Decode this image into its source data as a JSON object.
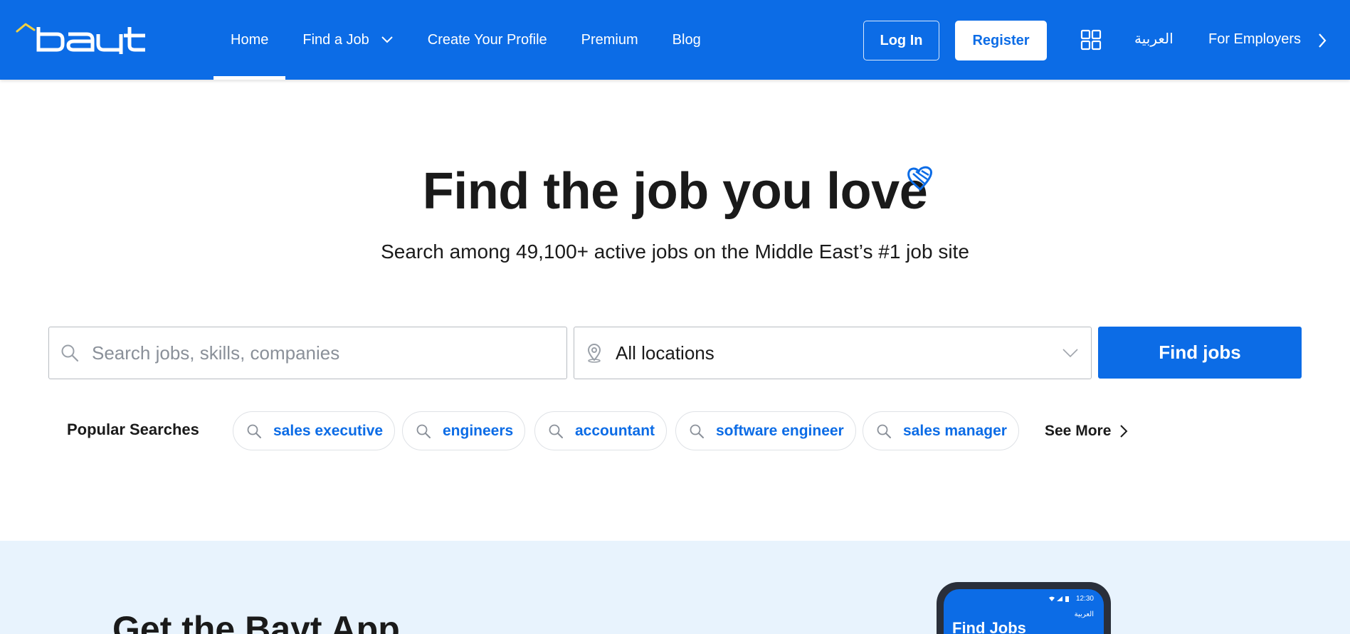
{
  "nav": {
    "links": [
      {
        "label": "Home"
      },
      {
        "label": "Find a Job"
      },
      {
        "label": "Create Your Profile"
      },
      {
        "label": "Premium"
      },
      {
        "label": "Blog"
      }
    ],
    "login_label": "Log In",
    "register_label": "Register",
    "language_label": "العربية",
    "employers_label": "For Employers",
    "icons": {
      "apps": "grid-apps-icon",
      "dropdown": "chevron-down-icon",
      "employers": "chevron-right-icon"
    }
  },
  "hero": {
    "title": "Find the job you love",
    "subtitle": "Search among 49,100+ active jobs on the Middle East’s #1 job site"
  },
  "search": {
    "placeholder": "Search jobs, skills, companies",
    "location_value": "All locations",
    "button_label": "Find jobs"
  },
  "popular": {
    "label": "Popular Searches",
    "chips": [
      {
        "label": "sales executive"
      },
      {
        "label": "engineers"
      },
      {
        "label": "accountant"
      },
      {
        "label": "software engineer"
      },
      {
        "label": "sales manager"
      }
    ],
    "see_more_label": "See More"
  },
  "app_section": {
    "title": "Get the Bayt App",
    "phone": {
      "time": "12:30",
      "language": "العربية",
      "find_jobs": "Find Jobs"
    }
  },
  "colors": {
    "brand_blue": "#0c6ce6",
    "app_section_bg": "#e8f3fd",
    "logo_accent": "#f4d03f"
  }
}
